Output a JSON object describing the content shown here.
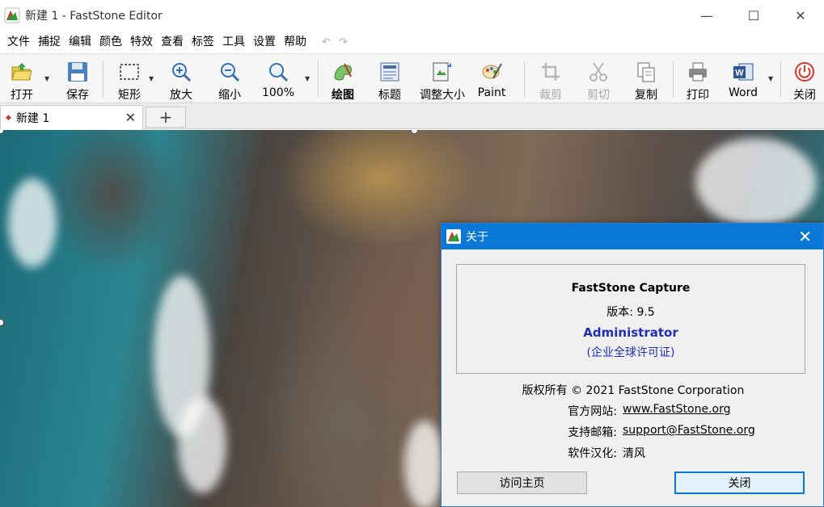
{
  "window": {
    "title": "新建 1 - FastStone Editor",
    "controls": {
      "minimize": "—",
      "maximize": "☐",
      "close": "✕"
    }
  },
  "menu": {
    "items": [
      "文件",
      "捕捉",
      "编辑",
      "颜色",
      "特效",
      "查看",
      "标签",
      "工具",
      "设置",
      "帮助"
    ],
    "undo": "↶",
    "redo": "↷"
  },
  "toolbar": {
    "open": "打开",
    "save": "保存",
    "rect": "矩形",
    "zoom_in": "放大",
    "zoom_out": "缩小",
    "zoom_100": "100%",
    "draw": "绘图",
    "caption": "标题",
    "resize": "调整大小",
    "paint": "Paint",
    "crop": "裁剪",
    "cut": "剪切",
    "copy": "复制",
    "print": "打印",
    "word": "Word",
    "word_icon_letter": "W",
    "close": "关闭",
    "caret": "▼"
  },
  "tabs": {
    "active": "新建 1",
    "active_marker": "◆",
    "close": "✕",
    "add": "+"
  },
  "about": {
    "title": "关于",
    "close": "✕",
    "product": "FastStone Capture",
    "version": "版本: 9.5",
    "user": "Administrator",
    "license": "(企业全球许可证)",
    "copyright": "版权所有 © 2021 FastStone Corporation",
    "website_label": "官方网站:",
    "website": "www.FastStone.org",
    "email_label": "支持邮箱:",
    "email": "support@FastStone.org",
    "localized_label": "软件汉化:",
    "localized_by": "清风",
    "home_button": "访问主页",
    "close_button": "关闭"
  },
  "colors": {
    "accent": "#0a78d7",
    "link_blue": "#1f2fb8",
    "dialog_bg": "#f0f0f0"
  }
}
